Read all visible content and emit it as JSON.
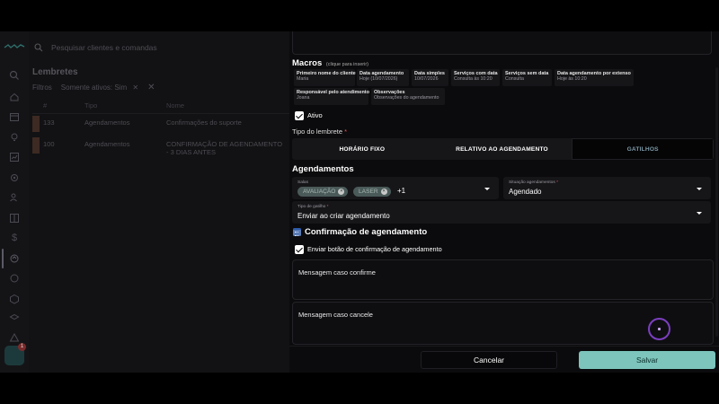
{
  "background": {
    "search_placeholder": "Pesquisar clientes e comandas",
    "section_title": "Lembretes",
    "filters_label": "Filtros",
    "filter_chip": "Somente ativos: Sim",
    "table_headers": [
      "#",
      "Tipo",
      "Nome"
    ],
    "rows": [
      {
        "id": "133",
        "tipo": "Agendamentos",
        "nome": "Confirmações do suporte"
      },
      {
        "id": "100",
        "tipo": "Agendamentos",
        "nome": "CONFIRMAÇÃO DE AGENDAMENTO - 3 DIAS ANTES"
      }
    ],
    "notification_count": "1"
  },
  "macros": {
    "title": "Macros",
    "hint": "(clique para inserir)",
    "items": [
      {
        "key": "Primeiro nome do cliente",
        "value": "Maria"
      },
      {
        "key": "Data agendamento",
        "value": "Hoje (10/07/2026)"
      },
      {
        "key": "Data simples",
        "value": "10/07/2026"
      },
      {
        "key": "Serviços com data",
        "value": "Consulta às 10:20"
      },
      {
        "key": "Serviços sem data",
        "value": "Consulta"
      },
      {
        "key": "Data agendamento por extenso",
        "value": "Hoje às 10:20"
      },
      {
        "key": "Responsável pelo atendimento",
        "value": "Joana"
      },
      {
        "key": "Observações",
        "value": "Observações do agendamento"
      }
    ]
  },
  "ativo": {
    "label": "Ativo",
    "checked": true
  },
  "tipo_lembrete": {
    "label": "Tipo do lembrete",
    "required_mark": "*",
    "options": [
      "HORÁRIO FIXO",
      "RELATIVO AO AGENDAMENTO",
      "GATILHOS"
    ],
    "selected": "GATILHOS"
  },
  "agendamentos": {
    "title": "Agendamentos",
    "salas": {
      "label": "Salas",
      "chips": [
        "AVALIAÇÃO",
        "LASER"
      ],
      "more": "+1"
    },
    "situacao": {
      "label": "Situação agendamentos",
      "required_mark": "*",
      "value": "Agendado"
    },
    "gatilho": {
      "label": "Tipo de gatilho",
      "required_mark": "*",
      "value": "Enviar ao criar agendamento"
    }
  },
  "confirmacao": {
    "title": "Confirmação de agendamento",
    "enviar_label": "Enviar botão de confirmação de agendamento",
    "enviar_checked": true,
    "msg_confirm_label": "Mensagem caso confirme",
    "msg_cancel_label": "Mensagem caso cancele"
  },
  "footer": {
    "cancel_label": "Cancelar",
    "save_label": "Salvar"
  },
  "colors": {
    "accent": "#7cc4bc",
    "selected_tab_text": "#7d9aa8",
    "recording_ring": "#7b3fbf"
  }
}
